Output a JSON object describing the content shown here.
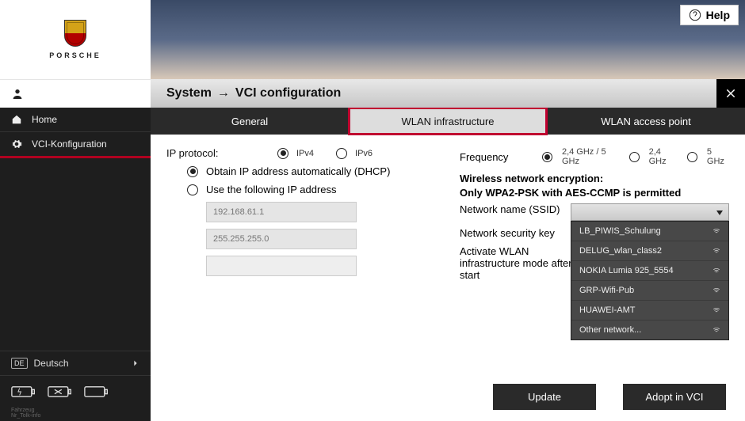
{
  "brand": "PORSCHE",
  "help": "Help",
  "sidebar": {
    "home": "Home",
    "vci": "VCI-Konfiguration",
    "lang_code": "DE",
    "lang_label": "Deutsch"
  },
  "breadcrumb": {
    "a": "System",
    "b": "VCI configuration"
  },
  "tabs": {
    "general": "General",
    "wlan_infra": "WLAN infrastructure",
    "wlan_ap": "WLAN access point"
  },
  "ip": {
    "label": "IP protocol:",
    "ipv4": "IPv4",
    "ipv6": "IPv6",
    "dhcp": "Obtain IP address automatically (DHCP)",
    "static": "Use the following IP address",
    "field_ip": "192.168.61.1",
    "field_mask": "255.255.255.0"
  },
  "freq": {
    "label": "Frequency",
    "both": "2,4 GHz / 5 GHz",
    "g24": "2,4 GHz",
    "g5": "5 GHz"
  },
  "enc": {
    "h1": "Wireless network encryption:",
    "h2": "Only WPA2-PSK with AES-CCMP is permitted",
    "ssid": "Network name (SSID)",
    "key": "Network security key",
    "activate": "Activate WLAN infrastructure mode after start"
  },
  "networks": [
    "LB_PIWIS_Schulung",
    "DELUG_wlan_class2",
    "NOKIA Lumia 925_5554",
    "GRP-Wifi-Pub",
    "HUAWEI-AMT",
    "Other network..."
  ],
  "buttons": {
    "update": "Update",
    "adopt": "Adopt in VCI"
  }
}
